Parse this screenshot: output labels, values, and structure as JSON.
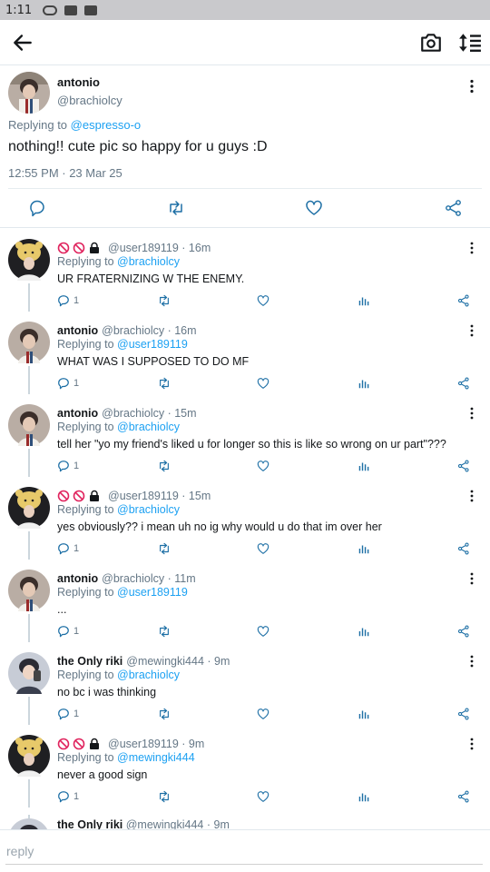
{
  "status_bar": {
    "time": "1:11"
  },
  "main_tweet": {
    "name": "antonio",
    "handle": "@brachiolcy",
    "replying_prefix": "Replying to ",
    "replying_to": "@espresso-o",
    "text": "nothing!! cute pic so happy for u guys :D",
    "date": "12:55 PM · 23 Mar 25"
  },
  "replies": [
    {
      "badges": true,
      "name": "",
      "handle": "@user189119",
      "time": "· 16m",
      "replying_prefix": "Replying to ",
      "replying_to": "@brachiolcy",
      "text": "UR FRATERNIZING W THE ENEMY.",
      "reply_count": "1",
      "avatar": "bear"
    },
    {
      "badges": false,
      "name": "antonio",
      "handle": "@brachiolcy",
      "time": "· 16m",
      "replying_prefix": "Replying to ",
      "replying_to": "@user189119",
      "text": "WHAT WAS I SUPPOSED TO DO MF",
      "reply_count": "1",
      "avatar": "antonio"
    },
    {
      "badges": false,
      "name": "antonio",
      "handle": "@brachiolcy",
      "time": "· 15m",
      "replying_prefix": "Replying to ",
      "replying_to": "@brachiolcy",
      "text": "tell her \"yo my friend's liked u for longer so this is like so wrong on ur part\"???",
      "reply_count": "1",
      "avatar": "antonio"
    },
    {
      "badges": true,
      "name": "",
      "handle": "@user189119",
      "time": "· 15m",
      "replying_prefix": "Replying to ",
      "replying_to": "@brachiolcy",
      "text": "yes obviously?? i mean uh no ig why would u do that im over her",
      "reply_count": "1",
      "avatar": "bear"
    },
    {
      "badges": false,
      "name": "antonio",
      "handle": "@brachiolcy",
      "time": "· 11m",
      "replying_prefix": "Replying to ",
      "replying_to": "@user189119",
      "text": "...",
      "reply_count": "1",
      "avatar": "antonio"
    },
    {
      "badges": false,
      "name": "the Only riki",
      "handle": "@mewingki444",
      "time": "· 9m",
      "replying_prefix": "Replying to ",
      "replying_to": "@brachiolcy",
      "text": "no bc i was thinking",
      "reply_count": "1",
      "avatar": "riki"
    },
    {
      "badges": true,
      "name": "",
      "handle": "@user189119",
      "time": "· 9m",
      "replying_prefix": "Replying to ",
      "replying_to": "@mewingki444",
      "text": "never a good sign",
      "reply_count": "1",
      "avatar": "bear"
    }
  ],
  "partial_reply": {
    "name": "the Only riki",
    "handle": "@mewingki444",
    "time": "· 9m"
  },
  "composer": {
    "placeholder": "reply"
  },
  "colors": {
    "link": "#1da1f2",
    "muted": "#657786",
    "badge_red": "#e0245e"
  }
}
